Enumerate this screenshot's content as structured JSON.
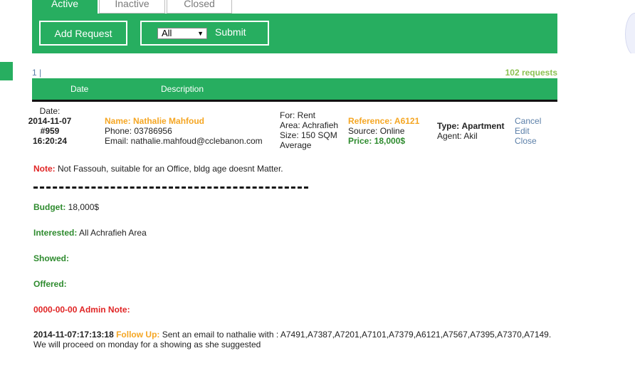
{
  "tabs": [
    {
      "label": "Active"
    },
    {
      "label": "Inactive"
    },
    {
      "label": "Closed"
    }
  ],
  "toolbar": {
    "add_label": "Add Request",
    "filter_value": "All",
    "submit_label": "Submit"
  },
  "pager": {
    "pages": "1 |",
    "count": "102 requests"
  },
  "table": {
    "col_date": "Date",
    "col_description": "Description"
  },
  "request": {
    "date_label": "Date:",
    "date": "2014-11-07",
    "id": "#959",
    "time": "16:20:24",
    "name": "Name: Nathalie Mahfoud",
    "phone": "Phone: 03786956",
    "email": "Email: nathalie.mahfoud@cclebanon.com",
    "for": "For: Rent",
    "area": "Area: Achrafieh",
    "size": "Size: 150 SQM",
    "condition": "Average",
    "reference": "Reference: A6121",
    "source": "Source: Online",
    "price": "Price: 18,000$",
    "type_label": "Type:",
    "type_value": "Apartment",
    "agent": "Agent: Akil",
    "actions": [
      "Cancel",
      "Edit",
      "Close"
    ]
  },
  "note": {
    "label": "Note:",
    "text": " Not Fassouh, suitable for an Office, bldg age doesnt Matter."
  },
  "details": {
    "budget_label": "Budget:",
    "budget_value": " 18,000$",
    "interested_label": "Interested:",
    "interested_value": " All Achrafieh Area",
    "showed_label": "Showed:",
    "offered_label": "Offered:",
    "admin_note": "0000-00-00 Admin Note:"
  },
  "followup": {
    "timestamp": "2014-11-07:17:13:18",
    "label": " Follow Up:",
    "text": " Sent an email to nathalie with : A7491,A7387,A7201,A7101,A7379,A6121,A7567,A7395,A7370,A7149. We will proceed on monday for a showing as she suggested"
  },
  "colors": {
    "accent": "#27ae60",
    "orange": "#f5a623",
    "label_green": "#2e8b2e",
    "red": "#e02424",
    "link": "#5b7fa8"
  }
}
